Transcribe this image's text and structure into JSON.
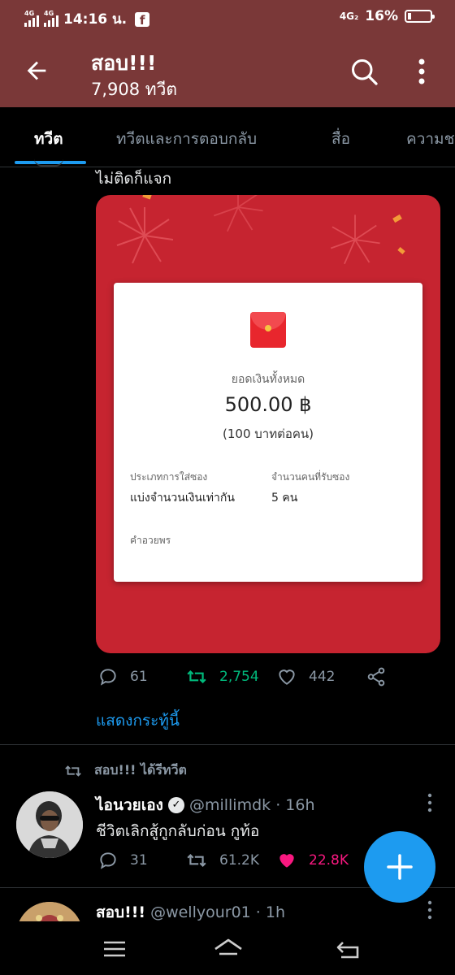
{
  "status_bar": {
    "network_1": "4G",
    "network_2": "4G",
    "time": "14:16 น.",
    "app_icon": "facebook-icon",
    "network_right": "4G₂",
    "battery_percent": "16%",
    "battery_level": 0.16
  },
  "header": {
    "title": "สอบ!!!",
    "subtitle": "7,908 ทวีต",
    "color": "#7a3838"
  },
  "tabs": [
    {
      "label": "ทวีต",
      "active": true
    },
    {
      "label": "ทวีตและการตอบกลับ",
      "active": false
    },
    {
      "label": "สื่อ",
      "active": false
    },
    {
      "label": "ความช",
      "active": false
    }
  ],
  "tweet1": {
    "text": "ไม่ติดก็แจก",
    "red_packet": {
      "total_label": "ยอดเงินทั้งหมด",
      "total_amount": "500.00 ฿",
      "per_person": "(100 บาทต่อคน)",
      "type_label": "ประเภทการใส่ซอง",
      "type_value": "แบ่งจำนวนเงินเท่ากัน",
      "recipients_label": "จำนวนคนที่รับซอง",
      "recipients_value": "5 คน",
      "blessing_label": "คำอวยพร"
    },
    "replies": "61",
    "retweets": "2,754",
    "likes": "442",
    "show_thread": "แสดงกระทู้นี้"
  },
  "tweet2": {
    "retweeted_by": "สอบ!!! ได้รีทวีต",
    "name": "ไอนวยเอง",
    "handle_time": "@millimdk · 16h",
    "text": "ชีวิตเลิกสู้กูกลับก่อน กูท้อ",
    "replies": "31",
    "retweets": "61.2K",
    "likes": "22.8K"
  },
  "tweet3": {
    "name": "สอบ!!!",
    "handle_time": "@wellyour01 · 1h"
  },
  "colors": {
    "accent": "#1d9bf0",
    "retweet_green": "#00ba7c",
    "like_pink": "#f91880",
    "packet_red": "#c62430"
  }
}
